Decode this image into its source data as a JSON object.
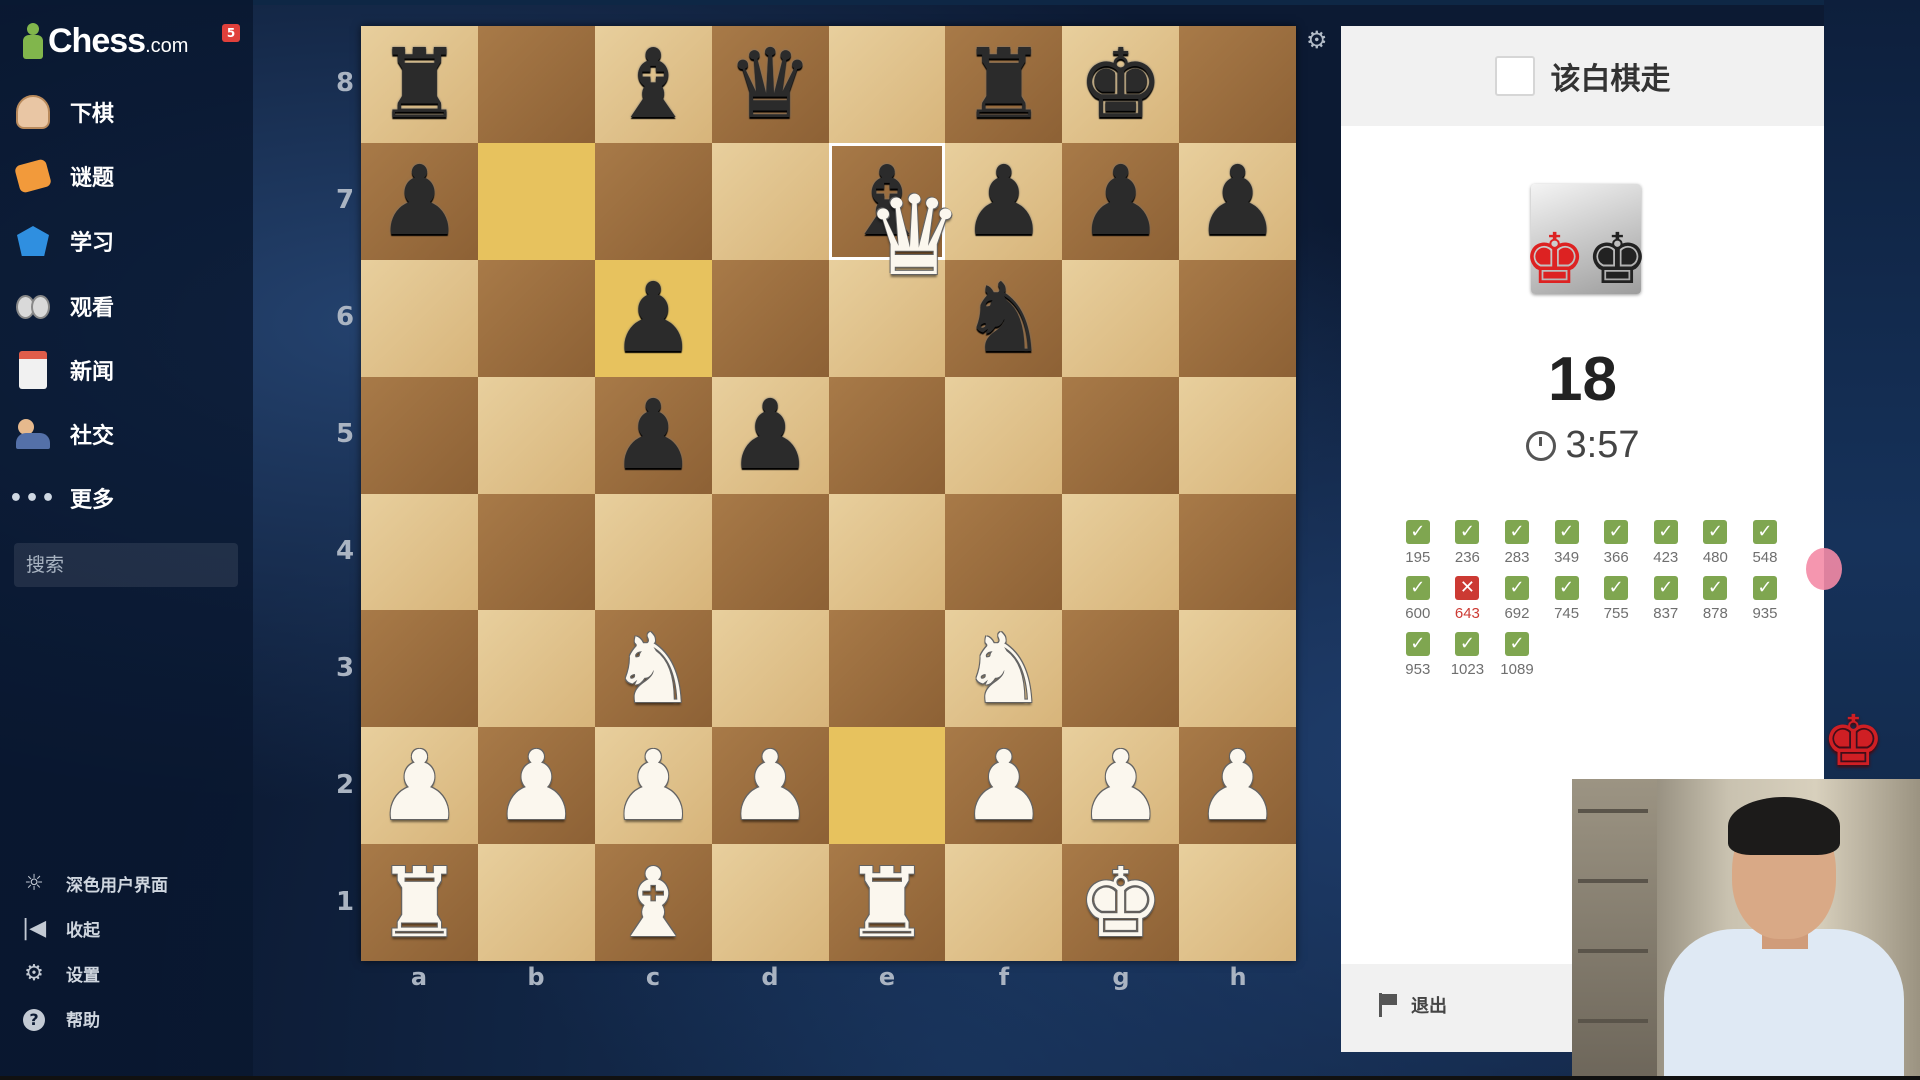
{
  "sidebar": {
    "logo": {
      "text": "Chess",
      "suffix": ".com"
    },
    "notification_count": "5",
    "nav": [
      {
        "label": "下棋",
        "icon": "play-icon"
      },
      {
        "label": "谜题",
        "icon": "puzzle-icon"
      },
      {
        "label": "学习",
        "icon": "learn-icon"
      },
      {
        "label": "观看",
        "icon": "watch-icon"
      },
      {
        "label": "新闻",
        "icon": "news-icon"
      },
      {
        "label": "社交",
        "icon": "social-icon"
      },
      {
        "label": "更多",
        "icon": "more-icon"
      }
    ],
    "search": {
      "placeholder": "搜索",
      "value": ""
    },
    "bottom": [
      {
        "label": "深色用户界面",
        "icon": "sun-icon"
      },
      {
        "label": "收起",
        "icon": "collapse-icon"
      },
      {
        "label": "设置",
        "icon": "gear-icon"
      },
      {
        "label": "帮助",
        "icon": "help-icon"
      }
    ]
  },
  "board": {
    "ranks": [
      "8",
      "7",
      "6",
      "5",
      "4",
      "3",
      "2",
      "1"
    ],
    "files": [
      "a",
      "b",
      "c",
      "d",
      "e",
      "f",
      "g",
      "h"
    ],
    "rows": [
      [
        "bR",
        "",
        "bB",
        "bQ",
        "",
        "bR",
        "bK",
        ""
      ],
      [
        "bP",
        "",
        "",
        "",
        "bB",
        "bP",
        "bP",
        "bP"
      ],
      [
        "",
        "",
        "bP",
        "",
        "",
        "bN",
        "",
        ""
      ],
      [
        "",
        "",
        "bP",
        "bP",
        "",
        "",
        "",
        ""
      ],
      [
        "",
        "",
        "",
        "",
        "",
        "",
        "",
        ""
      ],
      [
        "",
        "",
        "wN",
        "",
        "",
        "wN",
        "",
        ""
      ],
      [
        "wP",
        "wP",
        "wP",
        "wP",
        "",
        "wP",
        "wP",
        "wP"
      ],
      [
        "wR",
        "",
        "wB",
        "",
        "wR",
        "",
        "wK",
        ""
      ]
    ],
    "highlighted_squares": [
      "b7",
      "c6",
      "e2"
    ],
    "selected_square": "e7",
    "dragged_piece": "wQ"
  },
  "panel": {
    "turn_text": "该白棋走",
    "score": "18",
    "timer": "3:57",
    "results": [
      {
        "value": "195",
        "ok": true
      },
      {
        "value": "236",
        "ok": true
      },
      {
        "value": "283",
        "ok": true
      },
      {
        "value": "349",
        "ok": true
      },
      {
        "value": "366",
        "ok": true
      },
      {
        "value": "423",
        "ok": true
      },
      {
        "value": "480",
        "ok": true
      },
      {
        "value": "548",
        "ok": true
      },
      {
        "value": "600",
        "ok": true
      },
      {
        "value": "643",
        "ok": false
      },
      {
        "value": "692",
        "ok": true
      },
      {
        "value": "745",
        "ok": true
      },
      {
        "value": "755",
        "ok": true
      },
      {
        "value": "837",
        "ok": true
      },
      {
        "value": "878",
        "ok": true
      },
      {
        "value": "935",
        "ok": true
      },
      {
        "value": "953",
        "ok": true
      },
      {
        "value": "1023",
        "ok": true
      },
      {
        "value": "1089",
        "ok": true
      }
    ],
    "exit_label": "退出"
  },
  "colors": {
    "light_square": "#e8cf9d",
    "dark_square": "#a87a48",
    "highlight": "#e7c25e",
    "ok": "#7fa650",
    "fail": "#cc3a33"
  }
}
